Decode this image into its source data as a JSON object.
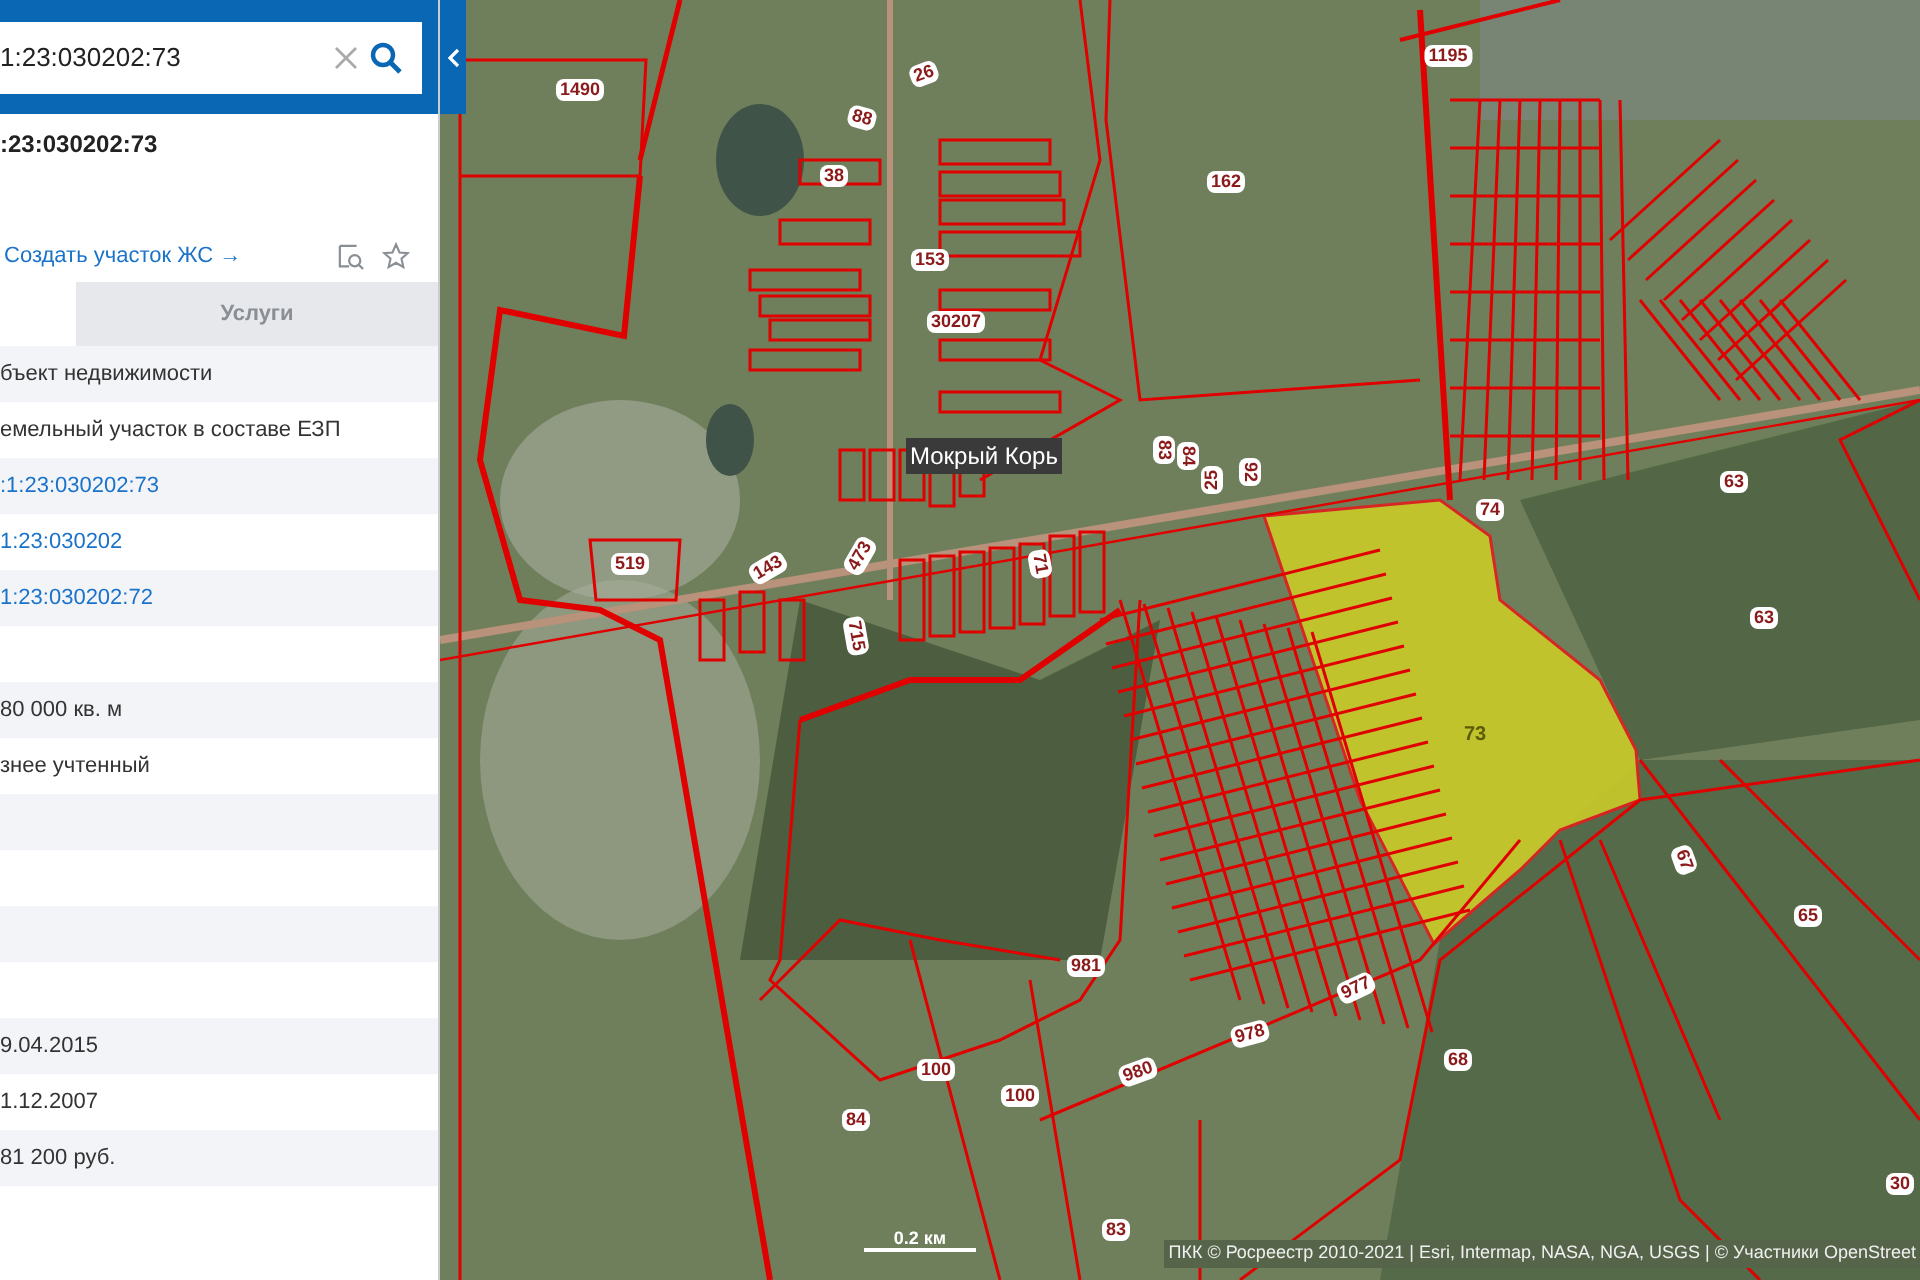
{
  "search": {
    "value": "1:23:030202:73"
  },
  "object_title": ":23:030202:73",
  "create_link": "Создать участок ЖС →",
  "tabs": [
    {
      "label": "Услуги",
      "selected": false
    }
  ],
  "properties": [
    {
      "kind": "text",
      "value": "бъект недвижимости"
    },
    {
      "kind": "text",
      "value": "емельный участок в составе ЕЗП"
    },
    {
      "kind": "link",
      "value": ":1:23:030202:73"
    },
    {
      "kind": "link",
      "value": "1:23:030202"
    },
    {
      "kind": "link",
      "value": "1:23:030202:72"
    },
    {
      "kind": "blank"
    },
    {
      "kind": "text",
      "value": "80 000 кв. м"
    },
    {
      "kind": "text",
      "value": "знее учтенный"
    },
    {
      "kind": "blank"
    },
    {
      "kind": "blank"
    },
    {
      "kind": "blank"
    },
    {
      "kind": "blank"
    },
    {
      "kind": "text",
      "value": "9.04.2015"
    },
    {
      "kind": "text",
      "value": "1.12.2007"
    },
    {
      "kind": "text",
      "value": "81 200 руб."
    },
    {
      "kind": "blank"
    }
  ],
  "map": {
    "place_name": "Мокрый Корь",
    "selected_parcel_label": "73",
    "scale": "0.2 км",
    "attribution": "ПКК © Росреестр 2010-2021 | Esri, Intermap, NASA, NGA, USGS | © Участники OpenStreet",
    "parcel_labels": [
      "1490",
      "26",
      "88",
      "38",
      "162",
      "1195",
      "153",
      "30207",
      "83",
      "84",
      "25",
      "92",
      "74",
      "63",
      "63",
      "519",
      "143",
      "473",
      "71",
      "715",
      "67",
      "65",
      "981",
      "977",
      "978",
      "980",
      "100",
      "100",
      "84",
      "68",
      "83",
      "30"
    ]
  }
}
